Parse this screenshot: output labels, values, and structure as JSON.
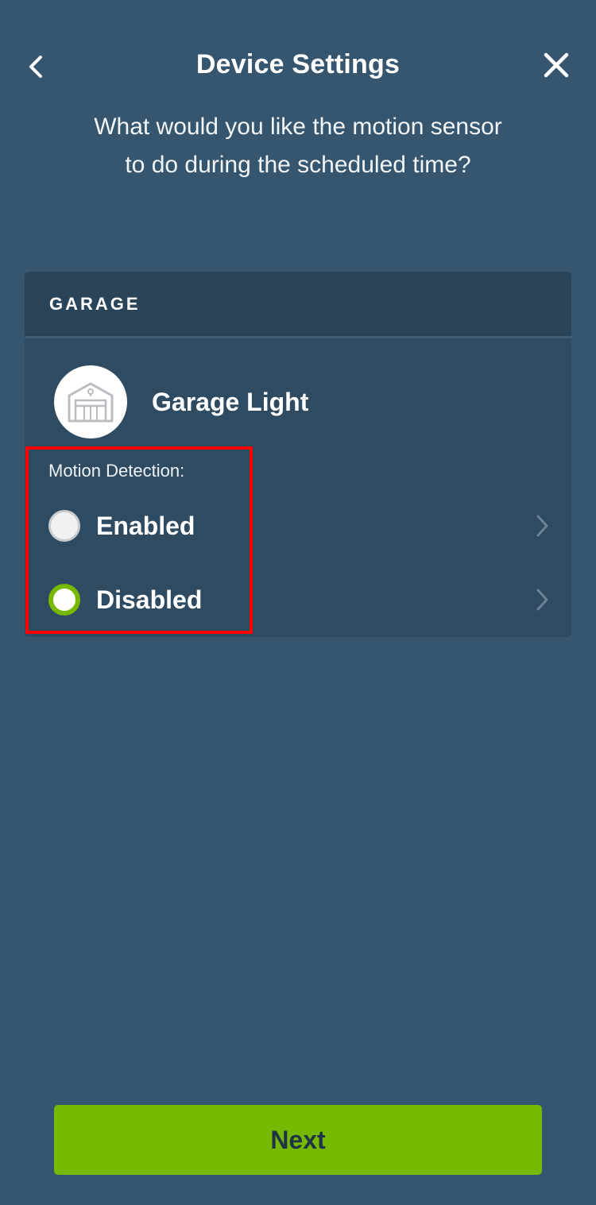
{
  "header": {
    "title": "Device Settings",
    "back_icon": "chevron-left-icon",
    "close_icon": "close-icon"
  },
  "prompt": "What would you like the motion sensor to do during the scheduled time?",
  "card": {
    "section_title": "GARAGE",
    "device": {
      "name": "Garage Light",
      "icon": "garage-icon"
    },
    "motion_detection_label": "Motion Detection:",
    "options": [
      {
        "label": "Enabled",
        "selected": false
      },
      {
        "label": "Disabled",
        "selected": true
      }
    ]
  },
  "next_button": "Next",
  "colors": {
    "background": "#36556f",
    "card": "#2f4b62",
    "accent": "#76b900",
    "highlight": "#ff0000"
  }
}
